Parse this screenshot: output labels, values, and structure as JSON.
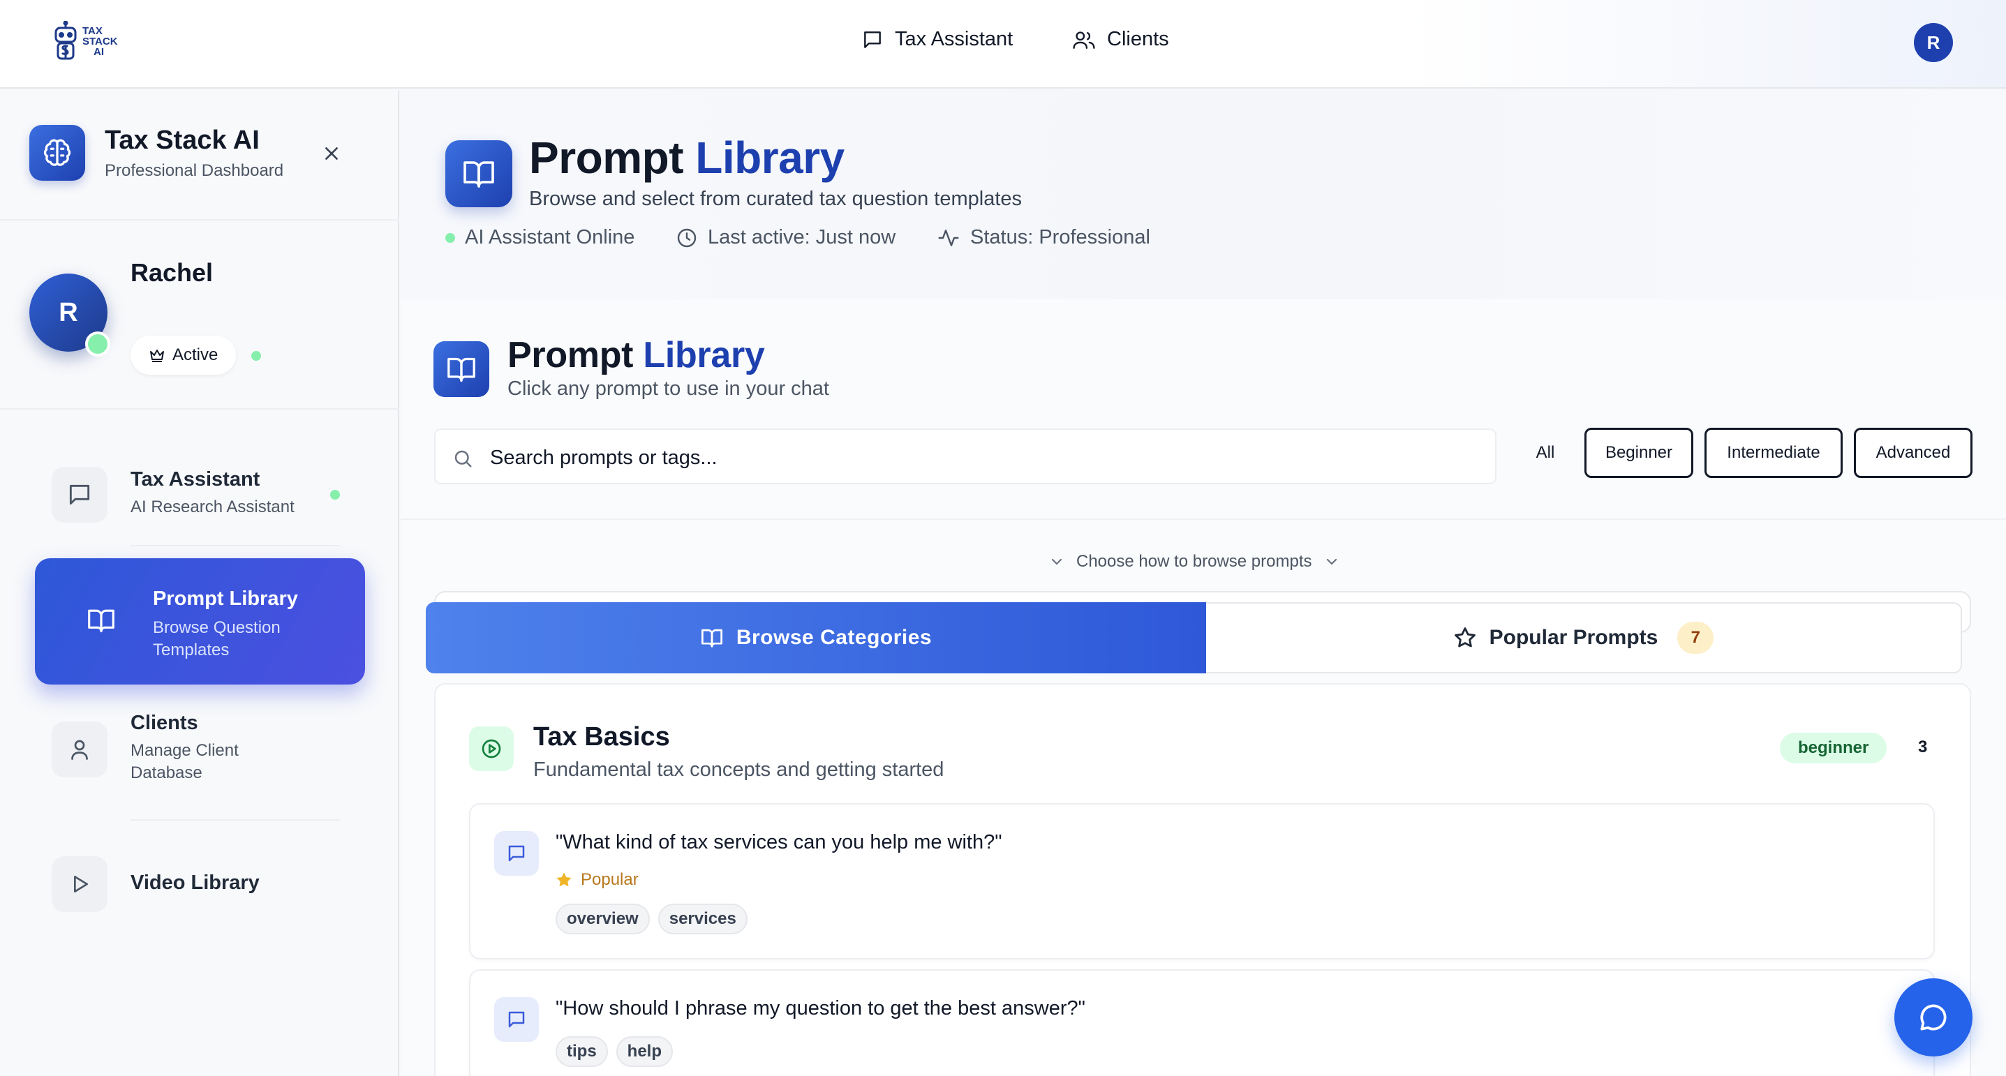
{
  "logo": {
    "line1": "TAX",
    "line2": "STACK",
    "line3": "AI"
  },
  "topnav": {
    "tax_assistant": "Tax Assistant",
    "clients": "Clients",
    "avatar_initial": "R"
  },
  "sidebar": {
    "brand_title": "Tax Stack AI",
    "brand_subtitle": "Professional Dashboard",
    "user": {
      "initial": "R",
      "name": "Rachel",
      "badge": "Active"
    },
    "items": [
      {
        "title": "Tax Assistant",
        "subtitle": "AI Research Assistant"
      },
      {
        "title": "Prompt Library",
        "subtitle": "Browse Question Templates"
      },
      {
        "title": "Clients",
        "subtitle": "Manage Client Database"
      },
      {
        "title": "Video Library",
        "subtitle": ""
      }
    ]
  },
  "header": {
    "title_part1": "Prompt ",
    "title_part2": "Library",
    "subtitle": "Browse and select from curated tax question templates",
    "status": {
      "online": "AI Assistant Online",
      "last_active": "Last active: Just now",
      "status": "Status: Professional"
    }
  },
  "library": {
    "title_part1": "Prompt ",
    "title_part2": "Library",
    "subtitle": "Click any prompt to use in your chat",
    "search_placeholder": "Search prompts or tags...",
    "levels": [
      "All",
      "Beginner",
      "Intermediate",
      "Advanced"
    ],
    "browse_hint": "Choose how to browse prompts",
    "tabs": {
      "browse": "Browse Categories",
      "popular": "Popular Prompts",
      "popular_count": "7"
    },
    "category": {
      "title": "Tax Basics",
      "subtitle": "Fundamental tax concepts and getting started",
      "level": "beginner",
      "count": "3",
      "prompts": [
        {
          "text": "\"What kind of tax services can you help me with?\"",
          "popular_label": "Popular",
          "tags": [
            "overview",
            "services"
          ]
        },
        {
          "text": "\"How should I phrase my question to get the best answer?\"",
          "tags": [
            "tips",
            "help"
          ]
        }
      ]
    }
  },
  "colors": {
    "brand_blue": "#1e40af",
    "active_gradient_start": "#2e58d8",
    "active_gradient_end": "#4b50e0",
    "online_green": "#86efac",
    "popular_gold": "#b7791f"
  },
  "icons": {
    "logo": "robot-logo-icon",
    "chat": "message-square-icon",
    "clients": "users-icon",
    "brand": "brain-icon",
    "close": "close-icon",
    "crown": "crown-icon",
    "book": "book-open-icon",
    "user": "user-icon",
    "video": "play-icon",
    "clock": "clock-icon",
    "activity": "activity-icon",
    "search": "search-icon",
    "chevron": "chevron-down-icon",
    "star": "star-icon",
    "play_circle": "play-circle-icon",
    "fab": "chat-bubble-icon"
  }
}
